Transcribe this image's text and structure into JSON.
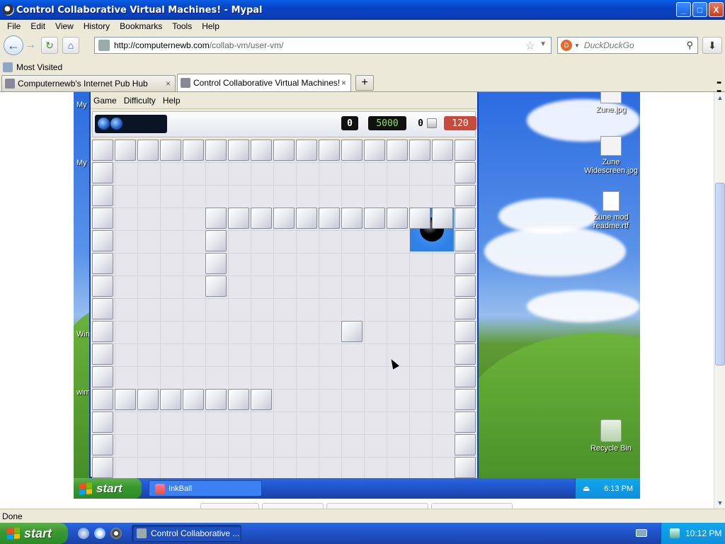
{
  "window": {
    "title": "Control Collaborative Virtual Machines! - Mypal",
    "minimize": "_",
    "maximize": "□",
    "close": "X"
  },
  "menubar": [
    "File",
    "Edit",
    "View",
    "History",
    "Bookmarks",
    "Tools",
    "Help"
  ],
  "nav": {
    "back": "←",
    "forward": "→",
    "reload": "↻",
    "home": "⌂",
    "url_host": "http://computernewb.com",
    "url_path": "/collab-vm/user-vm/",
    "bookmark_star": "☆",
    "search_placeholder": "DuckDuckGo",
    "download": "⬇"
  },
  "bookmarks": {
    "most_visited": "Most Visited"
  },
  "tabs": [
    {
      "label": "Computernewb's Internet Pub Hub",
      "close": "×"
    },
    {
      "label": "Control Collaborative Virtual Machines!",
      "close": "×"
    }
  ],
  "tab_new": "+",
  "vm": {
    "desktop_icons": [
      {
        "label": "Zune.jpg",
        "icon": "image-file-icon"
      },
      {
        "label": "Zune Widescreen.jpg",
        "icon": "image-file-icon"
      },
      {
        "label": "Zune mod readme.rtf",
        "icon": "document-icon"
      },
      {
        "label": "Recycle Bin",
        "icon": "recycle-bin-icon"
      }
    ],
    "left_labels": [
      "My",
      "My",
      "Win",
      "wim"
    ],
    "inkball": {
      "menu": [
        "Game",
        "Difficulty",
        "Help"
      ],
      "balls_remaining": "0",
      "score": "5000",
      "bonus": "0",
      "timer": "120"
    },
    "taskbar": {
      "start": "start",
      "task": "InkBall",
      "clock": "6:13 PM"
    }
  },
  "statusbar": {
    "text": "Done"
  },
  "taskbar": {
    "start": "start",
    "task": "Control Collaborative ...",
    "clock": "10:12 PM"
  }
}
